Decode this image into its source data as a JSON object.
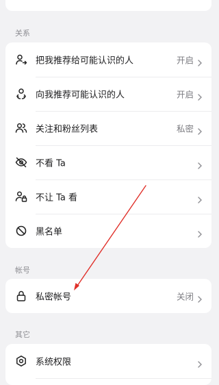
{
  "sections": {
    "relations": "关系",
    "account": "帐号",
    "other": "其它"
  },
  "relations_rows": [
    {
      "label": "把我推荐给可能认识的人",
      "value": "开启",
      "icon": "user-share-icon"
    },
    {
      "label": "向我推荐可能认识的人",
      "value": "开启",
      "icon": "user-recommend-icon"
    },
    {
      "label": "关注和粉丝列表",
      "value": "私密",
      "icon": "users-icon"
    },
    {
      "label": "不看 Ta",
      "value": "",
      "icon": "eye-off-icon"
    },
    {
      "label": "不让 Ta 看",
      "value": "",
      "icon": "user-lock-icon"
    },
    {
      "label": "黑名单",
      "value": "",
      "icon": "block-icon"
    }
  ],
  "account_rows": [
    {
      "label": "私密帐号",
      "value": "关闭",
      "icon": "lock-icon"
    }
  ],
  "other_rows": [
    {
      "label": "系统权限",
      "value": "",
      "icon": "settings-icon"
    }
  ],
  "colors": {
    "background": "#f2f2f4",
    "card": "#ffffff",
    "annotation_arrow": "#e0302a"
  }
}
